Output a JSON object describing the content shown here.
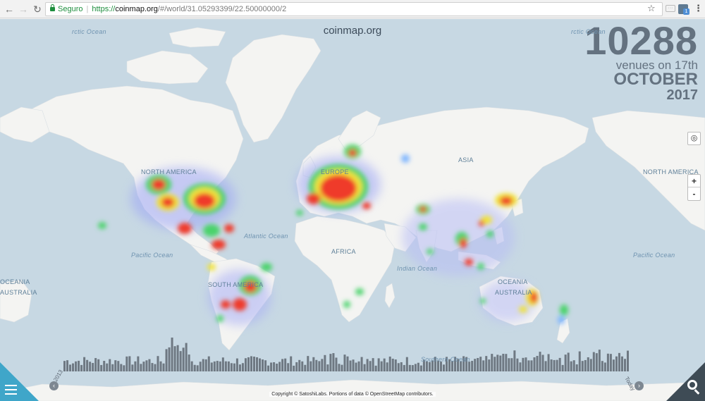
{
  "browser": {
    "secure_label": "Seguro",
    "url_protocol": "https://",
    "url_host": "coinmap.org",
    "url_path": "/#/world/31.05293399/22.50000000/2"
  },
  "site": {
    "title": "coinmap.org"
  },
  "counter": {
    "count": "10288",
    "venues_text": "venues on 17th",
    "month": "OCTOBER",
    "year": "2017"
  },
  "map_labels": {
    "north_america": "NORTH AMERICA",
    "north_america_right": "NORTH AMERICA",
    "south_america": "SOUTH AMERICA",
    "europe": "EUROPE",
    "asia": "ASIA",
    "africa": "AFRICA",
    "oceania_left": "OCEANIA",
    "australia_left": "AUSTRALIA",
    "oceania": "OCEANIA",
    "australia": "AUSTRALIA",
    "pacific_left": "Pacific Ocean",
    "pacific_right": "Pacific Ocean",
    "atlantic": "Atlantic Ocean",
    "indian": "Indian Ocean",
    "southern": "Southern Ocean",
    "arctic_left": "rctic Ocean",
    "arctic_right": "rctic Ocean"
  },
  "controls": {
    "locate_icon": "locate-icon",
    "zoom_in": "+",
    "zoom_out": "-"
  },
  "timeline": {
    "start_label": "2013",
    "end_label": "Today",
    "prev_arrow": "‹",
    "next_arrow": "›"
  },
  "footer": {
    "copyright": "Copyright © SatoshiLabs. Portions of data © OpenStreetMap contributors."
  },
  "colors": {
    "ocean": "#c7d8e3",
    "land": "#f4f4f2",
    "menu_corner": "#3fa6c9",
    "search_corner": "#3e4b55"
  }
}
